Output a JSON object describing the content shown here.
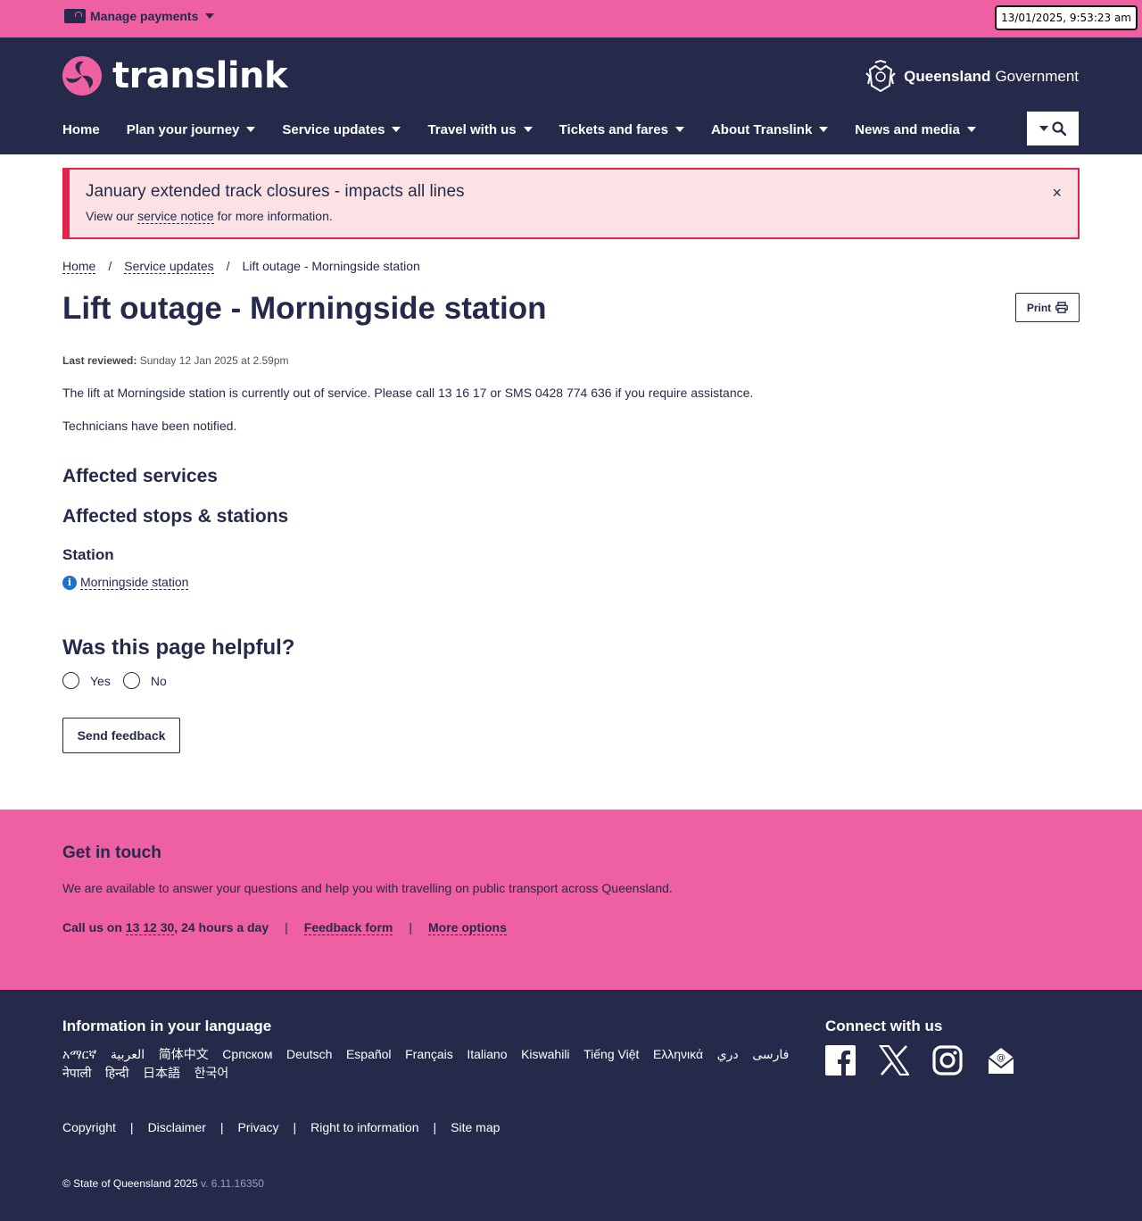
{
  "topbar": {
    "manage_label": "Manage payments",
    "datetime": "13/01/2025, 9:53:23 am"
  },
  "header": {
    "logo_text": "translink",
    "gov_bold": "Queensland",
    "gov_text": "Government",
    "nav": [
      "Home",
      "Plan your journey",
      "Service updates",
      "Travel with us",
      "Tickets and fares",
      "About Translink",
      "News and media"
    ]
  },
  "alert": {
    "title": "January extended track closures - impacts all lines",
    "text_pre": "View our",
    "link": "service notice",
    "text_post": "for more information.",
    "close": "×"
  },
  "breadcrumb": {
    "items": [
      "Home",
      "Service updates",
      "Lift outage - Morningside station"
    ],
    "sep": "/"
  },
  "page": {
    "title": "Lift outage - Morningside station",
    "print_label": "Print",
    "reviewed_label": "Last reviewed:",
    "reviewed_value": "Sunday 12 Jan 2025 at 2.59pm",
    "para1": "The lift at Morningside station is currently out of service. Please call 13 16 17 or SMS 0428 774 636 if you require assistance.",
    "para2": "Technicians have been notified.",
    "affected_services": "Affected services",
    "affected_stops": "Affected stops & stations",
    "station_heading": "Station",
    "station_link": "Morningside station",
    "info_glyph": "i",
    "helpful_heading": "Was this page helpful?",
    "yes": "Yes",
    "no": "No",
    "send_feedback": "Send feedback"
  },
  "touch": {
    "heading": "Get in touch",
    "text": "We are available to answer your questions and help you with travelling on public transport across Queensland.",
    "call_pre": "Call us on",
    "phone": "13 12 30",
    "call_post": ", 24 hours a day",
    "feedback": "Feedback form",
    "more": "More options",
    "sep": "|"
  },
  "footer": {
    "lang_heading": "Information in your language",
    "languages": [
      "አማርኛ",
      "العربية",
      "简体中文",
      "Српском",
      "Deutsch",
      "Español",
      "Français",
      "Italiano",
      "Kiswahili",
      "Tiếng Việt",
      "Ελληνικά",
      "دري",
      "فارسی",
      "नेपाली",
      "हिन्दी",
      "日本語",
      "한국어"
    ],
    "connect_heading": "Connect with us",
    "social_icons": [
      "facebook-icon",
      "x-icon",
      "instagram-icon",
      "email-icon"
    ],
    "legal": [
      "Copyright",
      "Disclaimer",
      "Privacy",
      "Right to information",
      "Site map"
    ],
    "sep": "|",
    "copyright": "© State of Queensland 2025",
    "version": "v. 6.11.16350"
  },
  "colors": {
    "navy": "#252a4a",
    "pink": "#ef60a3",
    "alert_red": "#e4234a",
    "alert_bg": "#fbe3e5",
    "info_blue": "#1a73c9"
  }
}
